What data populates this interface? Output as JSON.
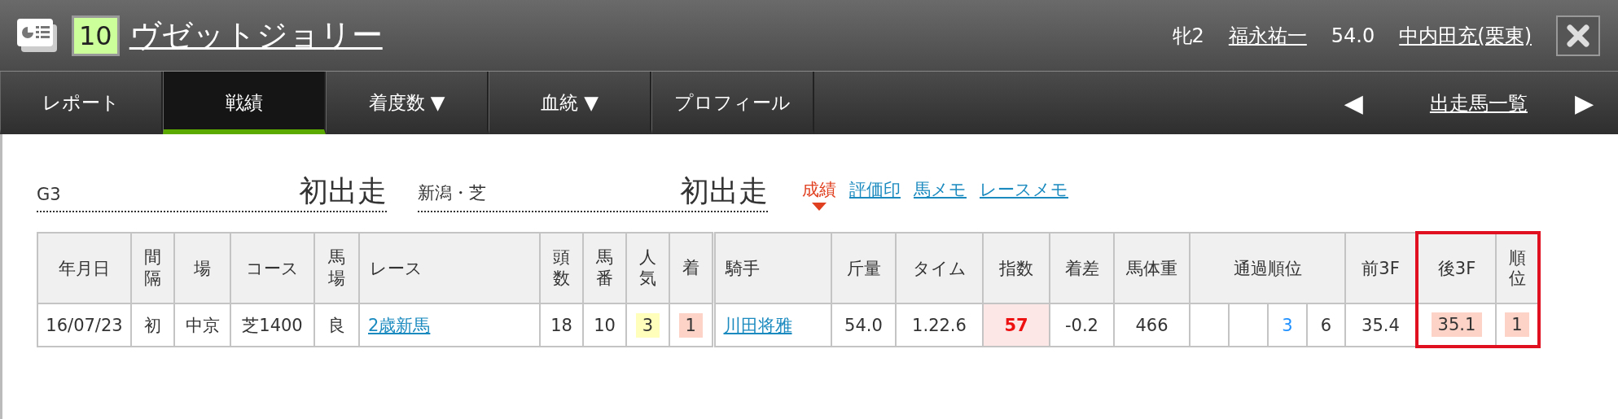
{
  "header": {
    "number": "10",
    "horse_name": "ヴゼットジョリー",
    "sex_age": "牝2",
    "jockey": "福永祐一",
    "weight": "54.0",
    "trainer": "中内田充(栗東)"
  },
  "tabs": [
    {
      "label": "レポート",
      "selected": false
    },
    {
      "label": "戦績",
      "selected": true
    },
    {
      "label": "着度数 ▼",
      "selected": false
    },
    {
      "label": "血統 ▼",
      "selected": false
    },
    {
      "label": "プロフィール",
      "selected": false
    }
  ],
  "nav": {
    "prev": "◀",
    "label": "出走馬一覧",
    "next": "▶"
  },
  "summary": [
    {
      "label": "G3",
      "value": "初出走"
    },
    {
      "label": "新潟・芝",
      "value": "初出走"
    }
  ],
  "links": [
    {
      "label": "成績",
      "selected": true
    },
    {
      "label": "評価印",
      "selected": false
    },
    {
      "label": "馬メモ",
      "selected": false
    },
    {
      "label": "レースメモ",
      "selected": false
    }
  ],
  "table": {
    "columns": [
      {
        "label": "年月日",
        "highlighted": false
      },
      {
        "label": "間隔",
        "highlighted": false
      },
      {
        "label": "場",
        "highlighted": false
      },
      {
        "label": "コース",
        "highlighted": false
      },
      {
        "label": "馬場",
        "highlighted": false
      },
      {
        "label": "レース",
        "highlighted": false
      },
      {
        "label": "頭数",
        "highlighted": false
      },
      {
        "label": "馬番",
        "highlighted": false
      },
      {
        "label": "人気",
        "highlighted": false
      },
      {
        "label": "着",
        "highlighted": false
      },
      {
        "label": "騎手",
        "highlighted": false
      },
      {
        "label": "斤量",
        "highlighted": false
      },
      {
        "label": "タイム",
        "highlighted": false
      },
      {
        "label": "指数",
        "highlighted": false
      },
      {
        "label": "着差",
        "highlighted": false
      },
      {
        "label": "馬体重",
        "highlighted": false
      },
      {
        "label": "通過順位",
        "highlighted": false
      },
      {
        "label": "前3F",
        "highlighted": false
      },
      {
        "label": "後3F",
        "highlighted": true
      },
      {
        "label": "順位",
        "highlighted": true
      }
    ],
    "rows": [
      {
        "cells": [
          {
            "kind": "plain",
            "text": "16/07/23"
          },
          {
            "kind": "plain",
            "text": "初"
          },
          {
            "kind": "plain",
            "text": "中京"
          },
          {
            "kind": "plain",
            "text": "芝1400"
          },
          {
            "kind": "plain",
            "text": "良"
          },
          {
            "kind": "link",
            "text": "2歳新馬"
          },
          {
            "kind": "plain",
            "text": "18"
          },
          {
            "kind": "plain",
            "text": "10"
          },
          {
            "kind": "popularity",
            "text": "3"
          },
          {
            "kind": "finish",
            "text": "1"
          },
          {
            "kind": "link",
            "text": "川田将雅"
          },
          {
            "kind": "plain",
            "text": "54.0"
          },
          {
            "kind": "plain",
            "text": "1.22.6"
          },
          {
            "kind": "index",
            "text": "57"
          },
          {
            "kind": "plain",
            "text": "-0.2"
          },
          {
            "kind": "plain",
            "text": "466"
          },
          {
            "kind": "passing",
            "values": [
              {
                "text": "3",
                "color": "#1e90ff"
              },
              {
                "text": "6",
                "color": "#333333"
              }
            ]
          },
          {
            "kind": "plain",
            "text": "35.4"
          },
          {
            "kind": "finish",
            "text": "35.1"
          },
          {
            "kind": "finish",
            "text": "1"
          }
        ]
      }
    ]
  }
}
